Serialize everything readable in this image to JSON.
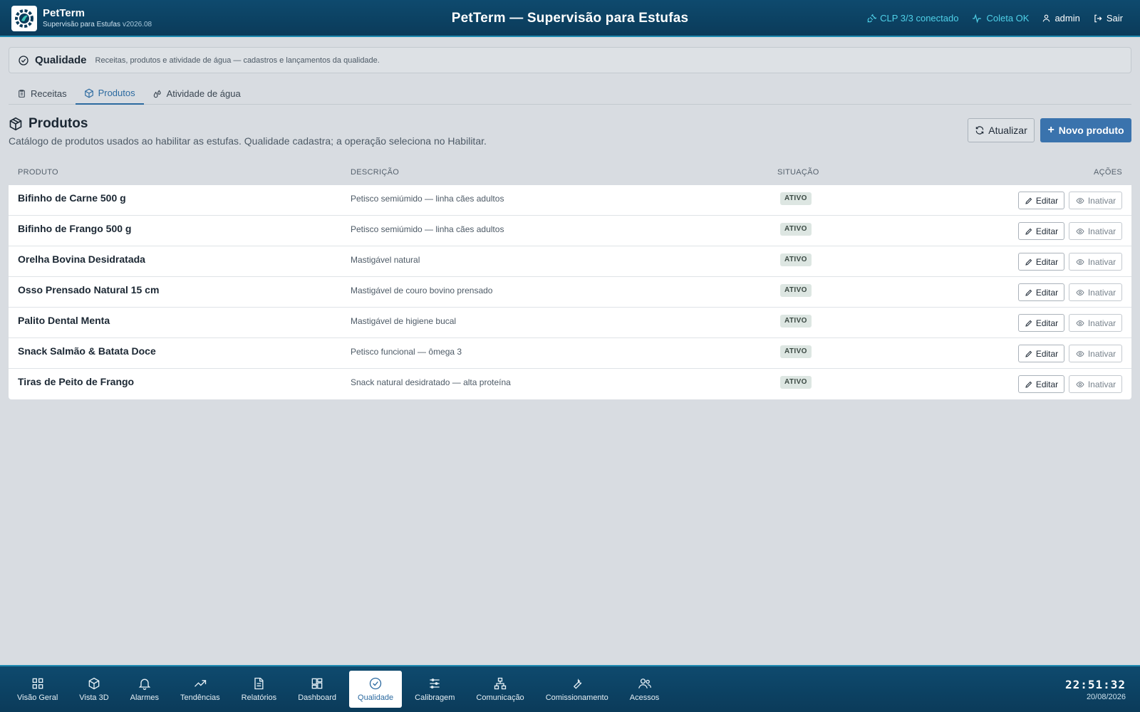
{
  "app": {
    "name": "PetTerm",
    "subtitle": "Supervisão para Estufas",
    "version": "v2026.08",
    "title": "PetTerm — Supervisão para Estufas"
  },
  "status": {
    "clp": "CLP 3/3 conectado",
    "coleta": "Coleta OK",
    "user": "admin",
    "logout": "Sair"
  },
  "section": {
    "title": "Qualidade",
    "description": "Receitas, produtos e atividade de água — cadastros e lançamentos da qualidade."
  },
  "tabs": [
    {
      "label": "Receitas",
      "icon": "clipboard-icon"
    },
    {
      "label": "Produtos",
      "icon": "box-icon",
      "active": true
    },
    {
      "label": "Atividade de água",
      "icon": "droplets-icon"
    }
  ],
  "page": {
    "title": "Produtos",
    "description": "Catálogo de produtos usados ao habilitar as estufas. Qualidade cadastra; a operação seleciona no Habilitar.",
    "refresh_label": "Atualizar",
    "new_label": "Novo produto"
  },
  "table": {
    "columns": {
      "product": "PRODUTO",
      "description": "DESCRIÇÃO",
      "status": "SITUAÇÃO",
      "actions": "AÇÕES"
    },
    "edit_label": "Editar",
    "deactivate_label": "Inativar",
    "rows": [
      {
        "name": "Bifinho de Carne 500 g",
        "description": "Petisco semiúmido — linha cães adultos",
        "status": "ATIVO"
      },
      {
        "name": "Bifinho de Frango 500 g",
        "description": "Petisco semiúmido — linha cães adultos",
        "status": "ATIVO"
      },
      {
        "name": "Orelha Bovina Desidratada",
        "description": "Mastigável natural",
        "status": "ATIVO"
      },
      {
        "name": "Osso Prensado Natural 15 cm",
        "description": "Mastigável de couro bovino prensado",
        "status": "ATIVO"
      },
      {
        "name": "Palito Dental Menta",
        "description": "Mastigável de higiene bucal",
        "status": "ATIVO"
      },
      {
        "name": "Snack Salmão & Batata Doce",
        "description": "Petisco funcional — ômega 3",
        "status": "ATIVO"
      },
      {
        "name": "Tiras de Peito de Frango",
        "description": "Snack natural desidratado — alta proteína",
        "status": "ATIVO"
      }
    ]
  },
  "nav": [
    {
      "label": "Visão Geral",
      "icon": "grid-icon"
    },
    {
      "label": "Vista 3D",
      "icon": "cube-icon"
    },
    {
      "label": "Alarmes",
      "icon": "bell-icon"
    },
    {
      "label": "Tendências",
      "icon": "trending-icon"
    },
    {
      "label": "Relatórios",
      "icon": "report-icon"
    },
    {
      "label": "Dashboard",
      "icon": "dashboard-icon"
    },
    {
      "label": "Qualidade",
      "icon": "check-circle-icon",
      "active": true
    },
    {
      "label": "Calibragem",
      "icon": "sliders-icon"
    },
    {
      "label": "Comunicação",
      "icon": "network-icon"
    },
    {
      "label": "Comissionamento",
      "icon": "wrench-icon"
    },
    {
      "label": "Acessos",
      "icon": "users-icon"
    }
  ],
  "clock": {
    "time": "22:51:32",
    "date": "20/08/2026"
  },
  "colors": {
    "header": "#0e4a6e",
    "accent": "#3a73ad",
    "cyan": "#4fd1e8"
  }
}
